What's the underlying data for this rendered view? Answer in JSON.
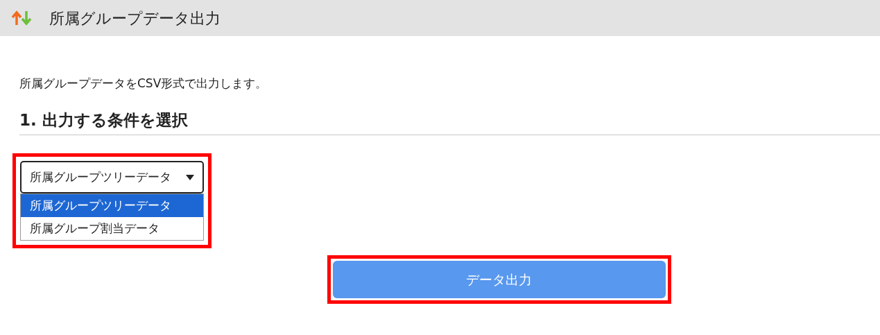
{
  "header": {
    "title": "所属グループデータ出力"
  },
  "description": "所属グループデータをCSV形式で出力します。",
  "section": {
    "heading": "1. 出力する条件を選択"
  },
  "dropdown": {
    "value": "所属グループツリーデータ",
    "expanded": true,
    "options": [
      {
        "label": "所属グループツリーデータ",
        "selected": true
      },
      {
        "label": "所属グループ割当データ",
        "selected": false
      }
    ]
  },
  "export_button": {
    "label": "データ出力"
  }
}
